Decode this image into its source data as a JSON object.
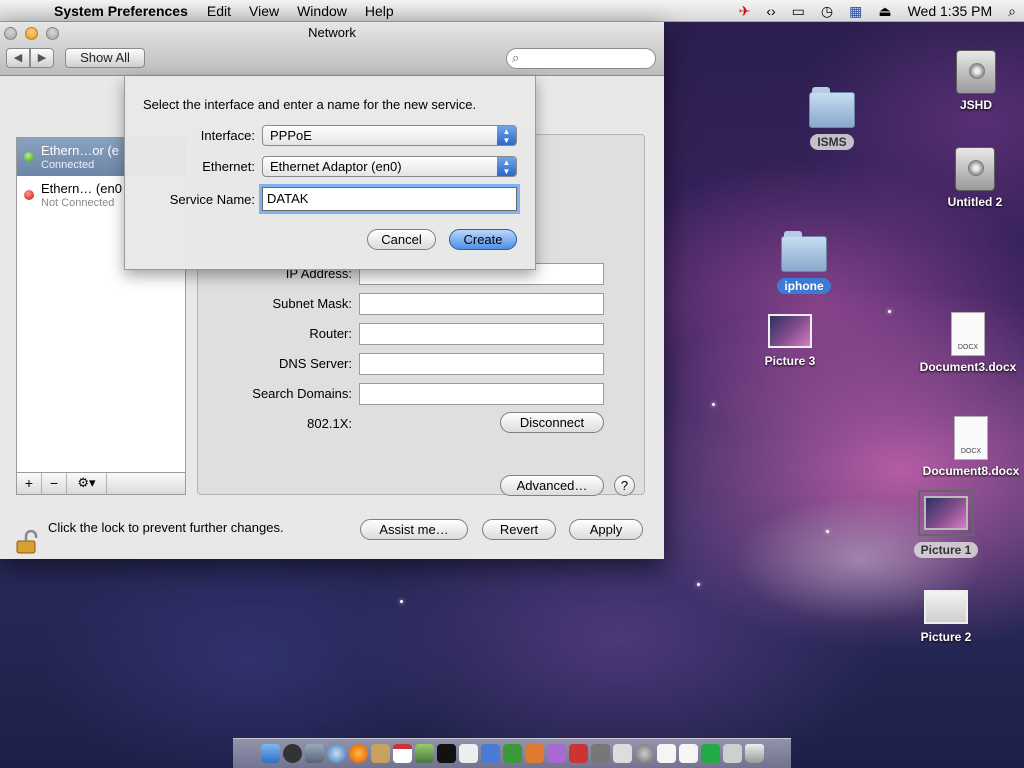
{
  "menubar": {
    "app_name": "System Preferences",
    "menus": [
      "Edit",
      "View",
      "Window",
      "Help"
    ],
    "clock": "Wed 1:35 PM"
  },
  "window": {
    "title": "Network",
    "show_all": "Show All",
    "search_placeholder": ""
  },
  "services": [
    {
      "name": "Ethern…or (e",
      "status": "Connected",
      "status_color": "#2f9a11"
    },
    {
      "name": "Ethern… (en0",
      "status": "Not Connected",
      "status_color": "#c81010"
    }
  ],
  "details": {
    "fields": [
      {
        "label": "IP Address:",
        "value": ""
      },
      {
        "label": "Subnet Mask:",
        "value": ""
      },
      {
        "label": "Router:",
        "value": ""
      },
      {
        "label": "DNS Server:",
        "value": ""
      },
      {
        "label": "Search Domains:",
        "value": ""
      }
    ],
    "dot1x_label": "802.1X:",
    "disconnect": "Disconnect",
    "advanced": "Advanced…",
    "help": "?"
  },
  "footer": {
    "lock_text": "Click the lock to prevent further changes.",
    "assist": "Assist me…",
    "revert": "Revert",
    "apply": "Apply"
  },
  "sheet": {
    "prompt": "Select the interface and enter a name for the new service.",
    "interface_label": "Interface:",
    "interface_value": "PPPoE",
    "ethernet_label": "Ethernet:",
    "ethernet_value": "Ethernet Adaptor (en0)",
    "service_name_label": "Service Name:",
    "service_name_value": "DATAK",
    "cancel": "Cancel",
    "create": "Create"
  },
  "desktop": {
    "jshd": "JSHD",
    "isms": "ISMS",
    "untitled2": "Untitled 2",
    "iphone": "iphone",
    "picture3": "Picture 3",
    "document3": "Document3.docx",
    "document8": "Document8.docx",
    "picture1": "Picture 1",
    "picture2": "Picture 2",
    "docx_badge": "DOCX"
  },
  "colors": {
    "accent": "#3d7ad6",
    "connected": "#2f9a11",
    "not_connected": "#c81010"
  }
}
